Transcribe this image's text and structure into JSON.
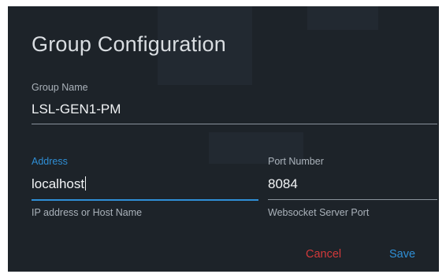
{
  "dialog": {
    "title": "Group Configuration",
    "group_name": {
      "label": "Group Name",
      "value": "LSL-GEN1-PM"
    },
    "address": {
      "label": "Address",
      "value": "localhost",
      "hint": "IP address or Host Name"
    },
    "port": {
      "label": "Port Number",
      "value": "8084",
      "hint": "Websocket Server Port"
    },
    "actions": {
      "cancel_label": "Cancel",
      "save_label": "Save"
    }
  },
  "colors": {
    "background": "#1d2329",
    "accent": "#2f8fd6",
    "danger": "#d2393a",
    "text": "#f2f4f6",
    "muted": "#aab2ba"
  }
}
